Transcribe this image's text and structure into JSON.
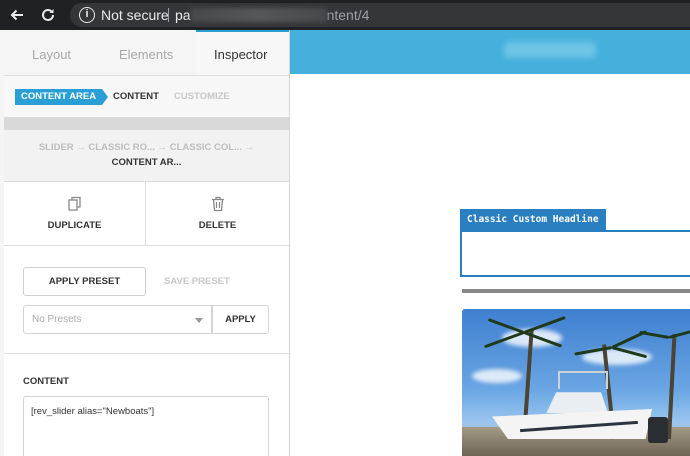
{
  "browser": {
    "back_icon": "arrow-left-icon",
    "reload_icon": "reload-icon",
    "security_label": "Not secure",
    "url_prefix": "pa",
    "url_suffix": "ntent/4"
  },
  "panel": {
    "tabs": [
      {
        "label": "Layout"
      },
      {
        "label": "Elements"
      },
      {
        "label": "Inspector"
      }
    ],
    "breadcrumb": {
      "active": "CONTENT AREA",
      "content": "CONTENT",
      "customize": "CUSTOMIZE"
    },
    "path": {
      "line1": "SLIDER → CLASSIC RO... → CLASSIC COL... →",
      "line2": "CONTENT AR..."
    },
    "actions": {
      "duplicate": "DUPLICATE",
      "delete": "DELETE"
    },
    "preset": {
      "apply_preset": "APPLY PRESET",
      "save_preset": "SAVE PRESET",
      "select_value": "No Presets",
      "apply": "APPLY"
    },
    "content": {
      "title": "CONTENT",
      "value": "[rev_slider alias=\"Newboats\"]"
    }
  },
  "preview": {
    "headline": "Classic Custom Headline"
  },
  "colors": {
    "accent": "#2a9fd6",
    "top_band": "#45b0dc",
    "headline": "#2a7fc0"
  }
}
